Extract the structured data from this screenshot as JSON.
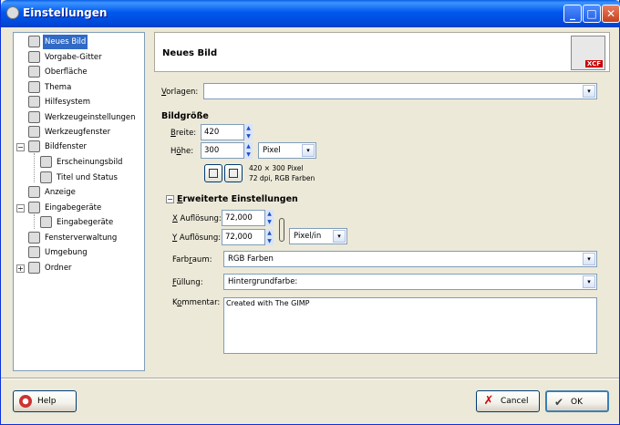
{
  "window": {
    "title": "Einstellungen",
    "buttons": [
      "_",
      "□",
      "✕"
    ]
  },
  "sidebar": {
    "items": [
      {
        "label": "Neues Bild",
        "icon": "image-icon",
        "selected": true
      },
      {
        "label": "Vorgabe-Gitter",
        "icon": "grid-icon"
      },
      {
        "label": "Oberfläche",
        "icon": "interface-icon"
      },
      {
        "label": "Thema",
        "icon": "theme-icon"
      },
      {
        "label": "Hilfesystem",
        "icon": "help-system-icon"
      },
      {
        "label": "Werkzeugeinstellungen",
        "icon": "tool-options-icon"
      },
      {
        "label": "Werkzeugfenster",
        "icon": "toolbox-icon"
      },
      {
        "label": "Bildfenster",
        "icon": "image-window-icon",
        "expander": "−"
      },
      {
        "label": "Erscheinungsbild",
        "icon": "appearance-icon"
      },
      {
        "label": "Titel und Status",
        "icon": "title-status-icon"
      },
      {
        "label": "Anzeige",
        "icon": "display-icon"
      },
      {
        "label": "Eingabegeräte",
        "icon": "input-devices-icon",
        "expander": "−"
      },
      {
        "label": "Eingabegeräte",
        "icon": "input-controllers-icon"
      },
      {
        "label": "Fensterverwaltung",
        "icon": "window-management-icon"
      },
      {
        "label": "Umgebung",
        "icon": "environment-icon"
      },
      {
        "label": "Ordner",
        "icon": "folders-icon",
        "expander": "+"
      }
    ]
  },
  "header": {
    "title": "Neues Bild",
    "logo": "XCF"
  },
  "form": {
    "templates_label": "Vorlagen:",
    "templates_value": "",
    "size_heading": "Bildgröße",
    "width_label": "Breite:",
    "width_value": "420",
    "height_label": "Höhe:",
    "height_value": "300",
    "unit": "Pixel",
    "info_line1": "420 × 300 Pixel",
    "info_line2": "72 dpi, RGB Farben",
    "advanced_heading": "Erweiterte Einstellungen",
    "advanced_expander": "−",
    "xres_label": "X Auflösung:",
    "xres_value": "72,000",
    "yres_label": "Y Auflösung:",
    "yres_value": "72,000",
    "res_unit": "Pixel/in",
    "colorspace_label": "Farbraum:",
    "colorspace_value": "RGB Farben",
    "fill_label": "Füllung:",
    "fill_value": "Hintergrundfarbe:",
    "comment_label": "Kommentar:",
    "comment_value": "Created with The GIMP"
  },
  "footer": {
    "help": "Help",
    "cancel": "Cancel",
    "ok": "OK"
  },
  "colors": {
    "titlebar": "#0058ee",
    "selection": "#316ac5",
    "dialog_bg": "#ece9d8"
  }
}
